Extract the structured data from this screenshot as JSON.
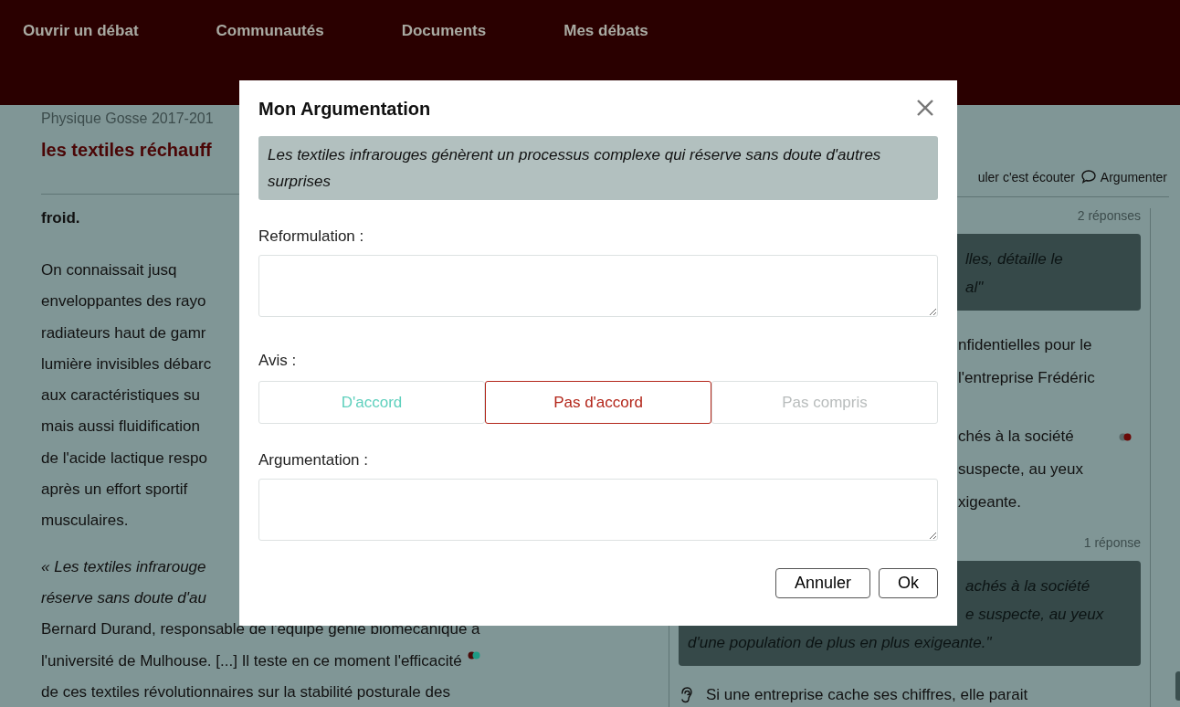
{
  "nav": {
    "items": [
      "Ouvrir un débat",
      "Communautés",
      "Documents",
      "Mes débats"
    ]
  },
  "document": {
    "course": "Physique Gosse 2017-201",
    "title": "les textiles réchauff",
    "subheading": "froid.",
    "paragraph_lines": [
      "On connaissait jusq",
      "enveloppantes des rayo",
      "radiateurs haut de gamr",
      "lumière invisibles débarc",
      "aux caractéristiques su",
      "mais aussi fluidification",
      "de l'acide lactique respo",
      "après un effort sportif",
      "musculaires."
    ],
    "quote_lines": [
      "« Les textiles infrarouge",
      "réserve sans doute d'au"
    ],
    "body_lines": [
      {
        "text": "Bernard Durand, responsable de l'équipe génie biomécanique à",
        "marked": false
      },
      {
        "text": "l'université de Mulhouse. [...] Il teste en ce moment l'efficacité",
        "marked": true
      },
      {
        "text": "de ces textiles révolutionnaires sur la stabilité posturale des",
        "marked": false
      }
    ]
  },
  "discussion": {
    "toolbar": {
      "text": "uler c'est écouter",
      "argue": "Argumenter"
    },
    "items": [
      {
        "kind": "count",
        "text": "2 réponses"
      },
      {
        "kind": "quote",
        "lines": [
          "lles, détaille le",
          "al\""
        ]
      },
      {
        "kind": "text",
        "lines": [
          "nfidentielles pour le",
          "l'entreprise Frédéric"
        ],
        "marked": false
      },
      {
        "kind": "text",
        "lines": [
          "chés à la société",
          "suspecte, au yeux",
          "xigeante."
        ],
        "marked": true
      },
      {
        "kind": "count",
        "text": "1 réponse"
      },
      {
        "kind": "quote",
        "lines": [
          "achés à la société",
          "e suspecte, au yeux",
          "d'une population de plus en plus exigeante.\""
        ]
      },
      {
        "kind": "reply",
        "lines": [
          "Si une entreprise cache ses chiffres, elle parait"
        ]
      }
    ]
  },
  "dialog": {
    "title": "Mon Argumentation",
    "quote": "Les textiles infrarouges génèrent un processus complexe qui réserve sans doute d'autres surprises",
    "reformulation_label": "Reformulation :",
    "avis_label": "Avis :",
    "avis_options": [
      {
        "label": "D'accord",
        "selected": false,
        "color": "#5fd0bd"
      },
      {
        "label": "Pas d'accord",
        "selected": true,
        "color": "#b3261a"
      },
      {
        "label": "Pas compris",
        "selected": false,
        "color": "#b8bcbc"
      }
    ],
    "argumentation_label": "Argumentation :",
    "buttons": [
      "Annuler",
      "Ok"
    ]
  }
}
